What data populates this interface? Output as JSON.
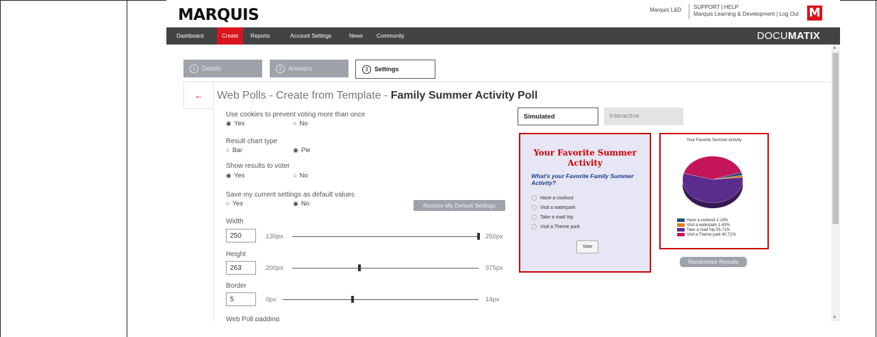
{
  "header": {
    "logo": "MARQUIS",
    "user": "Marquis L&D",
    "support": "SUPPORT | HELP",
    "org_logout": "Marquis Learning & Development | Log Out",
    "brand_mark": "M"
  },
  "nav": {
    "items": [
      "Dashboard",
      "Create",
      "Reports",
      "Account Settings",
      "News",
      "Community"
    ],
    "active": "Create",
    "product_light": "DOCU",
    "product_bold": "MATIX"
  },
  "steps": [
    {
      "num": "1",
      "label": "Details"
    },
    {
      "num": "2",
      "label": "Answers"
    },
    {
      "num": "3",
      "label": "Settings"
    }
  ],
  "page": {
    "back_icon": "←",
    "title_prefix": "Web Polls - Create from Template - ",
    "title_bold": "Family Summer Activity Poll"
  },
  "settings": {
    "cookies": {
      "label": "Use cookies to prevent voting more than once",
      "opt1": "Yes",
      "opt2": "No",
      "selected": "Yes"
    },
    "chart_type": {
      "label": "Result chart type",
      "opt1": "Bar",
      "opt2": "Pie",
      "selected": "Pie"
    },
    "show_results": {
      "label": "Show results to voter",
      "opt1": "Yes",
      "opt2": "No",
      "selected": "Yes"
    },
    "save_default": {
      "label": "Save my current settings as default values",
      "opt1": "Yes",
      "opt2": "No",
      "selected": "No"
    },
    "restore_button": "Restore My Default Settings",
    "width": {
      "label": "Width",
      "value": "250",
      "min": "130px",
      "max": "250px",
      "level": 1.0
    },
    "height": {
      "label": "Height",
      "value": "263",
      "min": "200px",
      "max": "375px",
      "level": 0.36
    },
    "border": {
      "label": "Border",
      "value": "5",
      "min": "0px",
      "max": "14px",
      "level": 0.357
    },
    "padding": {
      "label": "Web Poll padding"
    }
  },
  "preview": {
    "tab_simulated": "Simulated",
    "tab_interactive": "Interactive",
    "poll_title": "Your Favorite Summer Activity",
    "poll_question": "What's your Favorite Family Summer Activity?",
    "options": [
      "Have a cookout",
      "Visit a waterpark",
      "Take a road trip",
      "Visit a Theme park"
    ],
    "vote_button": "Vote",
    "randomize_button": "Randomize Results"
  },
  "chart_data": {
    "type": "pie",
    "title": "Your Favorite Summer Activity",
    "categories": [
      "Have a cookout",
      "Visit a waterpark",
      "Take a road trip",
      "Visit a Theme park"
    ],
    "values": [
      2.14,
      1.43,
      55.71,
      40.71
    ],
    "legend_labels": [
      "Have a cookout 2.14%",
      "Visit a waterpark 1.43%",
      "Take a road trip 55.71%",
      "Visit a Theme park 40.71%"
    ],
    "colors": [
      "#1f4e79",
      "#e07a1a",
      "#5b2c8e",
      "#c4145a"
    ],
    "legend": "bottom"
  },
  "colors": {
    "accent": "#d9141e",
    "nav_bg": "#424345",
    "step_inactive": "#9ea3aa"
  }
}
